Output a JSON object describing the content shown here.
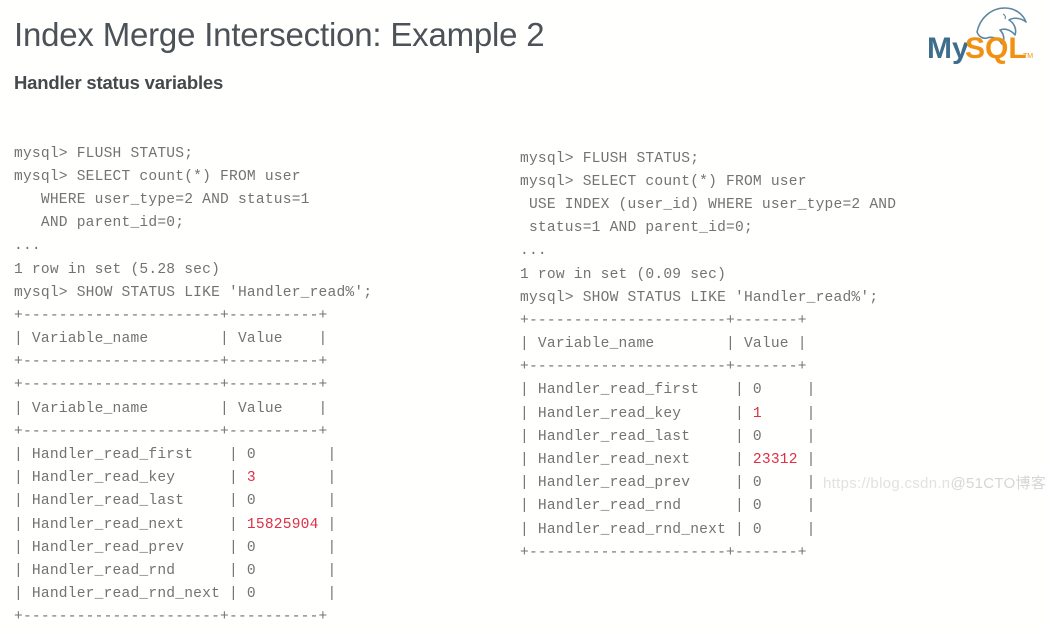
{
  "header": {
    "title": "Index Merge Intersection: Example 2",
    "subtitle": "Handler status variables",
    "logo": {
      "name": "mysql-logo",
      "text_my": "My",
      "text_sql": "SQL",
      "trademark": "TM",
      "color_my": "#3e6e8e",
      "color_sql": "#f29111",
      "color_dolphin": "#5d87a1"
    }
  },
  "watermark": {
    "url": "https://blog.csdn.n",
    "site": "@51CTO博客"
  },
  "colors": {
    "background": "#fffffe",
    "title": "#4c5257",
    "subtitle": "#45494d",
    "console_text": "#737373",
    "highlight_value": "#de2f46"
  },
  "console_left": {
    "name": "left-console-output",
    "lines": [
      "mysql> FLUSH STATUS;",
      "mysql> SELECT count(*) FROM user",
      "   WHERE user_type=2 AND status=1",
      "   AND parent_id=0;",
      "...",
      "1 row in set (5.28 sec)",
      "mysql> SHOW STATUS LIKE 'Handler_read%';",
      "+----------------------+----------+",
      "| Variable_name        | Value    |",
      "+----------------------+----------+"
    ],
    "table": {
      "border_top": "+----------------------+----------+",
      "header_name": "| Variable_name        | Value    |",
      "border_mid": "+----------------------+----------+",
      "border_bottom": "+----------------------+----------+",
      "rows": [
        {
          "prefix": "| Handler_read_first    | ",
          "value": "0",
          "highlight": false,
          "suffix": "        |"
        },
        {
          "prefix": "| Handler_read_key      | ",
          "value": "3",
          "highlight": true,
          "suffix": "        |"
        },
        {
          "prefix": "| Handler_read_last     | ",
          "value": "0",
          "highlight": false,
          "suffix": "        |"
        },
        {
          "prefix": "| Handler_read_next     | ",
          "value": "15825904",
          "highlight": true,
          "suffix": " |"
        },
        {
          "prefix": "| Handler_read_prev     | ",
          "value": "0",
          "highlight": false,
          "suffix": "        |"
        },
        {
          "prefix": "| Handler_read_rnd      | ",
          "value": "0",
          "highlight": false,
          "suffix": "        |"
        },
        {
          "prefix": "| Handler_read_rnd_next | ",
          "value": "0",
          "highlight": false,
          "suffix": "        |"
        }
      ]
    }
  },
  "console_right": {
    "name": "right-console-output",
    "lines": [
      "mysql> FLUSH STATUS;",
      "mysql> SELECT count(*) FROM user",
      " USE INDEX (user_id) WHERE user_type=2 AND",
      " status=1 AND parent_id=0;",
      "...",
      "1 row in set (0.09 sec)",
      "mysql> SHOW STATUS LIKE 'Handler_read%';"
    ],
    "table": {
      "border_top": "+----------------------+-------+",
      "header_name": "| Variable_name        | Value |",
      "border_mid": "+----------------------+-------+",
      "border_bottom": "+----------------------+-------+",
      "rows": [
        {
          "prefix": "| Handler_read_first    | ",
          "value": "0",
          "highlight": false,
          "suffix": "     |"
        },
        {
          "prefix": "| Handler_read_key      | ",
          "value": "1",
          "highlight": true,
          "suffix": "     |"
        },
        {
          "prefix": "| Handler_read_last     | ",
          "value": "0",
          "highlight": false,
          "suffix": "     |"
        },
        {
          "prefix": "| Handler_read_next     | ",
          "value": "23312",
          "highlight": true,
          "suffix": " |"
        },
        {
          "prefix": "| Handler_read_prev     | ",
          "value": "0",
          "highlight": false,
          "suffix": "     |"
        },
        {
          "prefix": "| Handler_read_rnd      | ",
          "value": "0",
          "highlight": false,
          "suffix": "     |"
        },
        {
          "prefix": "| Handler_read_rnd_next | ",
          "value": "0",
          "highlight": false,
          "suffix": "     |"
        }
      ]
    }
  }
}
